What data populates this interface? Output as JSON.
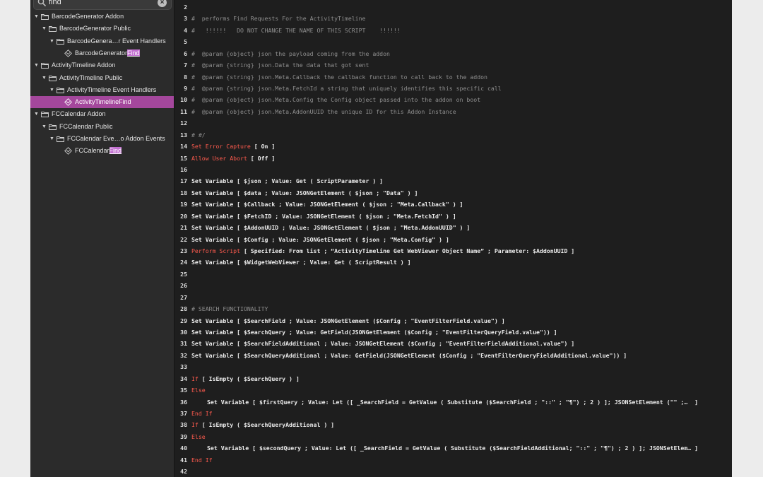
{
  "search": {
    "value": "find"
  },
  "tree": [
    {
      "label": "BarcodeGenerator Addon",
      "kind": "folder",
      "level": 0
    },
    {
      "label": "BarcodeGenerator Public",
      "kind": "folder",
      "level": 1
    },
    {
      "label": "BarcodeGenera…r Event Handlers",
      "kind": "folder",
      "level": 2
    },
    {
      "label_pre": "BarcodeGenerator",
      "label_hl": "Find",
      "kind": "script",
      "level": 3
    },
    {
      "label": "ActivityTimeline Addon",
      "kind": "folder",
      "level": 0
    },
    {
      "label": "ActivityTimeline Public",
      "kind": "folder",
      "level": 1
    },
    {
      "label": "ActivityTimeline Event Handlers",
      "kind": "folder",
      "level": 2
    },
    {
      "label_pre": "ActivityTimelineFind",
      "label_hl": "",
      "kind": "script",
      "level": 3,
      "selected": true
    },
    {
      "label": "FCCalendar Addon",
      "kind": "folder",
      "level": 0
    },
    {
      "label": "FCCalendar Public",
      "kind": "folder",
      "level": 1
    },
    {
      "label": "FCCalendar Eve…o Addon Events",
      "kind": "folder",
      "level": 2
    },
    {
      "label_pre": "FCCalendar",
      "label_hl": "Find",
      "kind": "script",
      "level": 3
    }
  ],
  "code_lines": [
    {
      "num": "2",
      "parts": []
    },
    {
      "num": "3",
      "parts": [
        {
          "t": "cmt",
          "s": "#  performs Find Requests For the ActivityTimeline"
        }
      ]
    },
    {
      "num": "4",
      "parts": [
        {
          "t": "cmt",
          "s": "#   !!!!!!   DO NOT CHANGE THE NAME OF THIS SCRIPT    !!!!!!"
        }
      ]
    },
    {
      "num": "5",
      "parts": []
    },
    {
      "num": "6",
      "parts": [
        {
          "t": "cmt",
          "s": "#  @param {object} json the payload coming from the addon"
        }
      ]
    },
    {
      "num": "7",
      "parts": [
        {
          "t": "cmt",
          "s": "#  @param {string} json.Data the data that got sent"
        }
      ]
    },
    {
      "num": "8",
      "parts": [
        {
          "t": "cmt",
          "s": "#  @param {string} json.Meta.Callback the callback function to call back to the addon"
        }
      ]
    },
    {
      "num": "9",
      "parts": [
        {
          "t": "cmt",
          "s": "#  @param {string} json.Meta.FetchId a string that uniquely identifies this specific call"
        }
      ]
    },
    {
      "num": "10",
      "parts": [
        {
          "t": "cmt",
          "s": "#  @param {object} json.Meta.Config the Config object passed into the addon on boot"
        }
      ]
    },
    {
      "num": "11",
      "parts": [
        {
          "t": "cmt",
          "s": "#  @param {object} json.Meta.AddonUUID the unique ID for this Addon Instance"
        }
      ]
    },
    {
      "num": "12",
      "parts": []
    },
    {
      "num": "13",
      "parts": [
        {
          "t": "cmt",
          "s": "# #/"
        }
      ]
    },
    {
      "num": "14",
      "parts": [
        {
          "t": "red",
          "s": "Set Error Capture"
        },
        {
          "t": "text",
          "s": " [ On ]"
        }
      ]
    },
    {
      "num": "15",
      "parts": [
        {
          "t": "red",
          "s": "Allow User Abort"
        },
        {
          "t": "text",
          "s": " [ Off ]"
        }
      ]
    },
    {
      "num": "16",
      "parts": []
    },
    {
      "num": "17",
      "parts": [
        {
          "t": "text",
          "s": "Set Variable [ $json ; Value: Get ( ScriptParameter ) ]"
        }
      ]
    },
    {
      "num": "18",
      "parts": [
        {
          "t": "text",
          "s": "Set Variable [ $data ; Value: JSONGetElement ( $json ; \"Data\" ) ]"
        }
      ]
    },
    {
      "num": "19",
      "parts": [
        {
          "t": "text",
          "s": "Set Variable [ $Callback ; Value: JSONGetElement ( $json ; \"Meta.Callback\" ) ]"
        }
      ]
    },
    {
      "num": "20",
      "parts": [
        {
          "t": "text",
          "s": "Set Variable [ $FetchID ; Value: JSONGetElement ( $json ; \"Meta.FetchId\" ) ]"
        }
      ]
    },
    {
      "num": "21",
      "parts": [
        {
          "t": "text",
          "s": "Set Variable [ $AddonUUID ; Value: JSONGetElement ( $json ; \"Meta.AddonUUID\" ) ]"
        }
      ]
    },
    {
      "num": "22",
      "parts": [
        {
          "t": "text",
          "s": "Set Variable [ $Config ; Value: JSONGetElement ( $json ; \"Meta.Config\" ) ]"
        }
      ]
    },
    {
      "num": "23",
      "parts": [
        {
          "t": "red",
          "s": "Perform Script"
        },
        {
          "t": "text",
          "s": " [ Specified: From list ; “ActivityTimeline Get WebViewer Object Name” ; Parameter: $AddonUUID ]"
        }
      ]
    },
    {
      "num": "24",
      "parts": [
        {
          "t": "text",
          "s": "Set Variable [ $WidgetWebViewer ; Value: Get ( ScriptResult ) ]"
        }
      ]
    },
    {
      "num": "25",
      "parts": []
    },
    {
      "num": "26",
      "parts": []
    },
    {
      "num": "27",
      "parts": []
    },
    {
      "num": "28",
      "parts": [
        {
          "t": "cmt",
          "s": "# SEARCH FUNCTIONALITY"
        }
      ]
    },
    {
      "num": "29",
      "parts": [
        {
          "t": "text",
          "s": "Set Variable [ $SearchField ; Value: JSONGetElement ($Config ; \"EventFilterField.value\") ]"
        }
      ]
    },
    {
      "num": "30",
      "parts": [
        {
          "t": "text",
          "s": "Set Variable [ $SearchQuery ; Value: GetField(JSONGetElement ($Config ; \"EventFilterQueryField.value\")) ]"
        }
      ]
    },
    {
      "num": "31",
      "parts": [
        {
          "t": "text",
          "s": "Set Variable [ $SearchFieldAdditional ; Value: JSONGetElement ($Config ; \"EventFilterFieldAdditional.value\") ]"
        }
      ]
    },
    {
      "num": "32",
      "parts": [
        {
          "t": "text",
          "s": "Set Variable [ $SearchQueryAdditional ; Value: GetField(JSONGetElement ($Config ; \"EventFilterQueryFieldAdditional.value\")) ]"
        }
      ]
    },
    {
      "num": "33",
      "parts": []
    },
    {
      "num": "34",
      "parts": [
        {
          "t": "red",
          "s": "If"
        },
        {
          "t": "text",
          "s": " [ IsEmpty ( $SearchQuery ) ]"
        }
      ]
    },
    {
      "num": "35",
      "parts": [
        {
          "t": "red",
          "s": "Else"
        }
      ]
    },
    {
      "num": "36",
      "indent": true,
      "parts": [
        {
          "t": "text",
          "s": "Set Variable [ $firstQuery ; Value: Let ([ _SearchField = GetValue ( Substitute ($SearchField ; \"::\" ; \"¶\") ; 2 ) ]; JSONSetElement (\"\" ;…  ]"
        }
      ]
    },
    {
      "num": "37",
      "parts": [
        {
          "t": "red",
          "s": "End If"
        }
      ]
    },
    {
      "num": "38",
      "parts": [
        {
          "t": "red",
          "s": "If"
        },
        {
          "t": "text",
          "s": " [ IsEmpty ( $SearchQueryAdditional ) ]"
        }
      ]
    },
    {
      "num": "39",
      "parts": [
        {
          "t": "red",
          "s": "Else"
        }
      ]
    },
    {
      "num": "40",
      "indent": true,
      "parts": [
        {
          "t": "text",
          "s": "Set Variable [ $secondQuery ; Value: Let ([ _SearchField = GetValue ( Substitute ($SearchFieldAdditional; \"::\" ; \"¶\") ; 2 ) ]; JSONSetElem… ]"
        }
      ]
    },
    {
      "num": "41",
      "parts": [
        {
          "t": "red",
          "s": "End If"
        }
      ]
    },
    {
      "num": "42",
      "parts": []
    }
  ]
}
